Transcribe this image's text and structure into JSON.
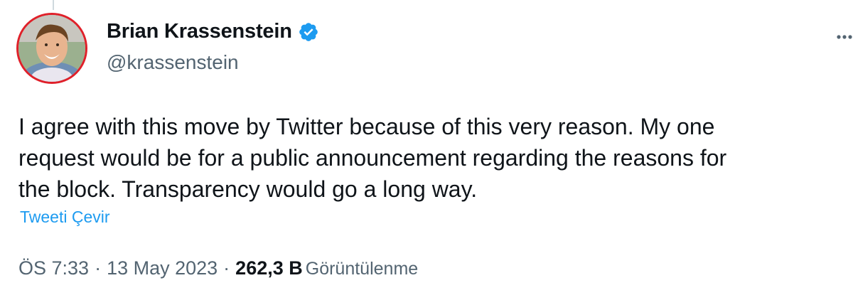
{
  "author": {
    "display_name": "Brian Krassenstein",
    "handle": "@krassenstein",
    "verified": true,
    "avatar_icon": "profile-photo"
  },
  "tweet": {
    "lines": [
      "I agree with this move by Twitter because of this very reason.  My one",
      "request would be for a public announcement regarding the reasons for",
      "the block.  Transparency would go a long way."
    ],
    "translate_label": "Tweeti Çevir"
  },
  "meta": {
    "time": "ÖS 7:33",
    "separator": "·",
    "date": "13 May 2023",
    "views_count": "262,3 B",
    "views_label": "Görüntülenme"
  },
  "colors": {
    "accent": "#1d9bf0",
    "secondary_text": "#536471",
    "primary_text": "#0f1419",
    "avatar_ring": "#e0202a"
  },
  "icons": {
    "verified": "verified-badge-icon",
    "more": "more-options-icon"
  }
}
